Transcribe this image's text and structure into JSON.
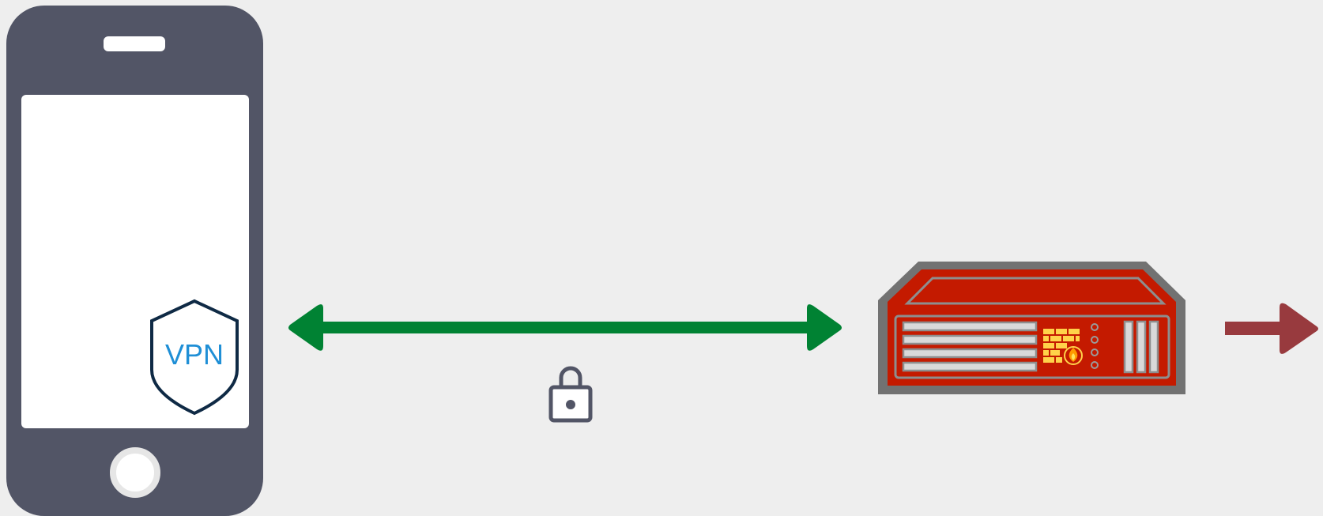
{
  "diagram": {
    "device": {
      "icon": "smartphone-icon",
      "badge_icon": "vpn-shield-icon",
      "badge_label": "VPN"
    },
    "tunnel": {
      "icon": "bidirectional-arrow-icon",
      "lock_icon": "padlock-icon",
      "color": "#008233"
    },
    "gateway": {
      "icon": "firewall-appliance-icon",
      "color": "#c41a00"
    },
    "egress": {
      "icon": "right-arrow-icon",
      "color": "#983a3e"
    },
    "colors": {
      "background": "#eeeeee",
      "phone": "#525566",
      "screen": "#ffffff",
      "shield_stroke": "#0f2a45",
      "vpn_text": "#1f8fd6",
      "chassis": "#727272"
    }
  }
}
